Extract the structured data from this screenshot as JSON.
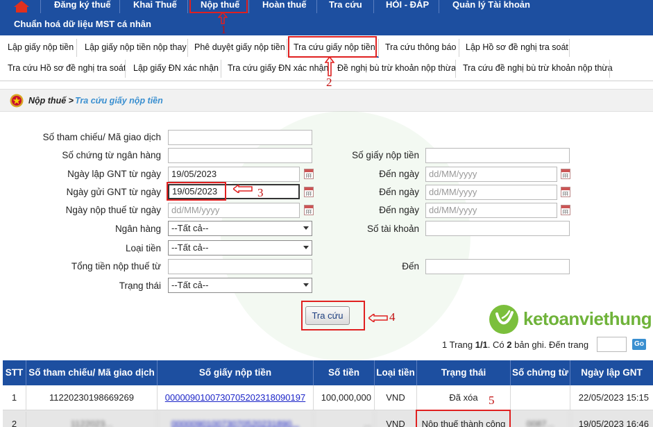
{
  "nav": {
    "items": [
      {
        "label": "Đăng ký thuế"
      },
      {
        "label": "Khai Thuế"
      },
      {
        "label": "Nộp thuế"
      },
      {
        "label": "Hoàn thuế"
      },
      {
        "label": "Tra cứu"
      },
      {
        "label": "HỎI - ĐÁP"
      },
      {
        "label": "Quản lý Tài khoản"
      }
    ],
    "sub": "Chuẩn hoá dữ liệu MST cá nhân"
  },
  "tabs": [
    {
      "label": "Lập giấy nộp tiền"
    },
    {
      "label": "Lập giấy nộp tiền nộp thay"
    },
    {
      "label": "Phê duyệt giấy nộp tiền"
    },
    {
      "label": "Tra cứu giấy nộp tiền"
    },
    {
      "label": "Tra cứu thông báo"
    },
    {
      "label": "Lập Hồ sơ đề nghị tra soát"
    },
    {
      "label": "Tra cứu Hồ sơ đề nghị tra soát"
    },
    {
      "label": "Lập giấy ĐN xác nhận"
    },
    {
      "label": "Tra cứu giấy ĐN xác nhận"
    },
    {
      "label": "Đề nghị bù trừ khoản nộp thừa"
    },
    {
      "label": "Tra cứu đề nghị bù trừ khoản nộp thừa"
    }
  ],
  "breadcrumb": {
    "root": "Nộp thuế >",
    "leaf": "Tra cứu giấy nộp tiền"
  },
  "form": {
    "ref_label": "Số tham chiếu/ Mã giao dịch",
    "bank_doc_label": "Số chứng từ ngân hàng",
    "gnt_no_label": "Số giấy nộp tiền",
    "create_from_label": "Ngày lập GNT từ ngày",
    "create_from_value": "19/05/2023",
    "to_label": "Đến ngày",
    "date_placeholder": "dd/MM/yyyy",
    "send_from_label": "Ngày gửi GNT từ ngày",
    "send_from_value": "19/05/2023",
    "pay_from_label": "Ngày nộp thuế từ ngày",
    "bank_label": "Ngân hàng",
    "all_option": "--Tất cả--",
    "account_label": "Số tài khoản",
    "currency_label": "Loại tiền",
    "total_from_label": "Tổng tiền nộp thuế từ",
    "total_to_label": "Đến",
    "status_label": "Trạng thái",
    "search_button": "Tra cứu"
  },
  "brand": "ketoanviethung",
  "pager": {
    "prefix": "1  Trang",
    "page": "1/1",
    "mid": ". Có",
    "count": "2",
    "suffix": "bản ghi. Đến trang",
    "go": "Go"
  },
  "table": {
    "headers": [
      "STT",
      "Số tham chiếu/ Mã giao dịch",
      "Số giấy nộp tiền",
      "Số tiền",
      "Loại tiền",
      "Trạng thái",
      "Số chứng từ",
      "Ngày lập GNT"
    ],
    "rows": [
      {
        "stt": "1",
        "ref": "11220230198669269",
        "gnt": "00000901007307052023180901​97",
        "amount": "100,000,000",
        "currency": "VND",
        "status": "Đã xóa",
        "doc": "",
        "date": "22/05/2023 15:15"
      },
      {
        "stt": "2",
        "ref": "1122023...",
        "gnt": "000009010073070520231890...",
        "amount": "...",
        "currency": "VND",
        "status": "Nộp thuế thành công",
        "doc": "0087...",
        "date": "19/05/2023 16:46"
      }
    ]
  },
  "annotations": [
    "1",
    "2",
    "3",
    "4",
    "5"
  ]
}
